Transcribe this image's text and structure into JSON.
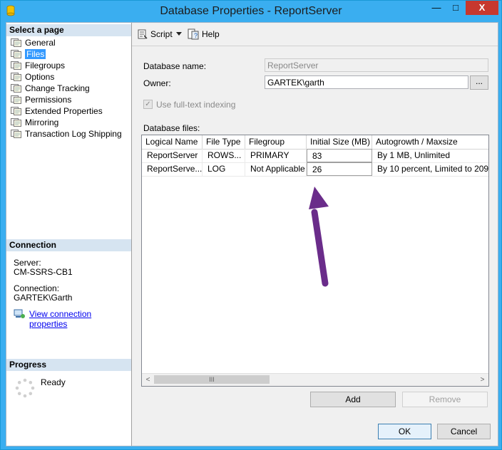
{
  "window": {
    "title": "Database Properties - ReportServer",
    "min_glyph": "—",
    "max_glyph": "□",
    "close_glyph": "X"
  },
  "left": {
    "select_page_header": "Select a page",
    "pages": [
      {
        "label": "General",
        "selected": false
      },
      {
        "label": "Files",
        "selected": true
      },
      {
        "label": "Filegroups",
        "selected": false
      },
      {
        "label": "Options",
        "selected": false
      },
      {
        "label": "Change Tracking",
        "selected": false
      },
      {
        "label": "Permissions",
        "selected": false
      },
      {
        "label": "Extended Properties",
        "selected": false
      },
      {
        "label": "Mirroring",
        "selected": false
      },
      {
        "label": "Transaction Log Shipping",
        "selected": false
      }
    ],
    "connection_header": "Connection",
    "server_label": "Server:",
    "server_value": "CM-SSRS-CB1",
    "connection_label": "Connection:",
    "connection_value": "GARTEK\\Garth",
    "view_connection_link": "View connection properties",
    "progress_header": "Progress",
    "progress_status": "Ready"
  },
  "toolbar": {
    "script_label": "Script",
    "help_label": "Help"
  },
  "form": {
    "database_name_label": "Database name:",
    "database_name_value": "ReportServer",
    "owner_label": "Owner:",
    "owner_value": "GARTEK\\garth",
    "owner_browse": "...",
    "fulltext_label": "Use full-text indexing",
    "fulltext_checked": true,
    "database_files_label": "Database files:"
  },
  "grid": {
    "headers": [
      "Logical Name",
      "File Type",
      "Filegroup",
      "Initial Size (MB)",
      "Autogrowth / Maxsize"
    ],
    "rows": [
      [
        "ReportServer",
        "ROWS...",
        "PRIMARY",
        "83",
        "By 1 MB, Unlimited"
      ],
      [
        "ReportServe...",
        "LOG",
        "Not Applicable",
        "26",
        "By 10 percent, Limited to 209..."
      ]
    ],
    "scroll_left": "<",
    "scroll_right": ">",
    "scroll_thumb": "III"
  },
  "buttons": {
    "add": "Add",
    "remove": "Remove",
    "ok": "OK",
    "cancel": "Cancel"
  },
  "colors": {
    "annotation_arrow": "#6a2c8a",
    "title_bar": "#3aaef0",
    "selection": "#3399ff"
  }
}
